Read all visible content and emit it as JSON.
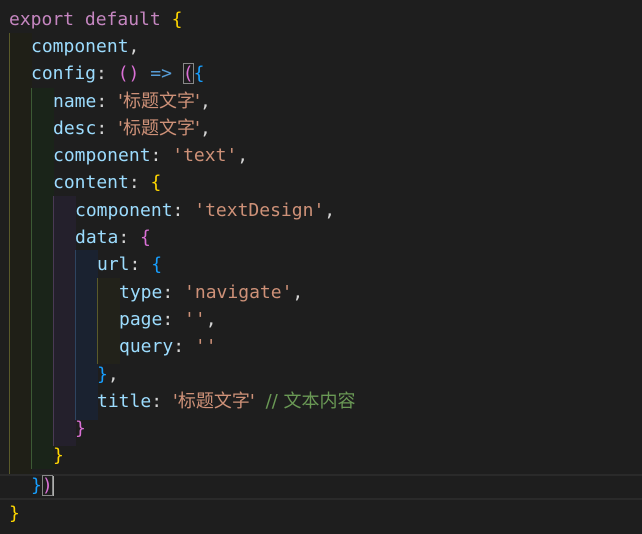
{
  "code": {
    "l1": {
      "export": "export",
      "default": "default",
      "brace": "{"
    },
    "l2": {
      "key": "component",
      "comma": ","
    },
    "l3": {
      "key": "config",
      "colon": ":",
      "parens": "()",
      "arrow": "=>",
      "open_paren": "(",
      "open_brace": "{"
    },
    "l4": {
      "key": "name",
      "colon": ":",
      "value": "'标题文字'",
      "comma": ","
    },
    "l5": {
      "key": "desc",
      "colon": ":",
      "value": "'标题文字'",
      "comma": ","
    },
    "l6": {
      "key": "component",
      "colon": ":",
      "value": "'text'",
      "comma": ","
    },
    "l7": {
      "key": "content",
      "colon": ":",
      "brace": "{"
    },
    "l8": {
      "key": "component",
      "colon": ":",
      "value": "'textDesign'",
      "comma": ","
    },
    "l9": {
      "key": "data",
      "colon": ":",
      "brace": "{"
    },
    "l10": {
      "key": "url",
      "colon": ":",
      "brace": "{"
    },
    "l11": {
      "key": "type",
      "colon": ":",
      "value": "'navigate'",
      "comma": ","
    },
    "l12": {
      "key": "page",
      "colon": ":",
      "value": "''",
      "comma": ","
    },
    "l13": {
      "key": "query",
      "colon": ":",
      "value": "''"
    },
    "l14": {
      "brace": "}",
      "comma": ","
    },
    "l15": {
      "key": "title",
      "colon": ":",
      "value": "'标题文字'",
      "comment": "// 文本内容"
    },
    "l16": {
      "brace": "}"
    },
    "l17": {
      "brace": "}"
    },
    "l18": {
      "brace": "}",
      "paren": ")"
    },
    "l19": {
      "brace": "}"
    }
  },
  "colors": {
    "background": "#1e1e1e",
    "keyword": "#c586c0",
    "property": "#9cdcfe",
    "string": "#ce9178",
    "comment": "#6a9955",
    "bracket_level1": "#ffd700",
    "bracket_level2": "#da70d6",
    "bracket_level3": "#179fff"
  }
}
